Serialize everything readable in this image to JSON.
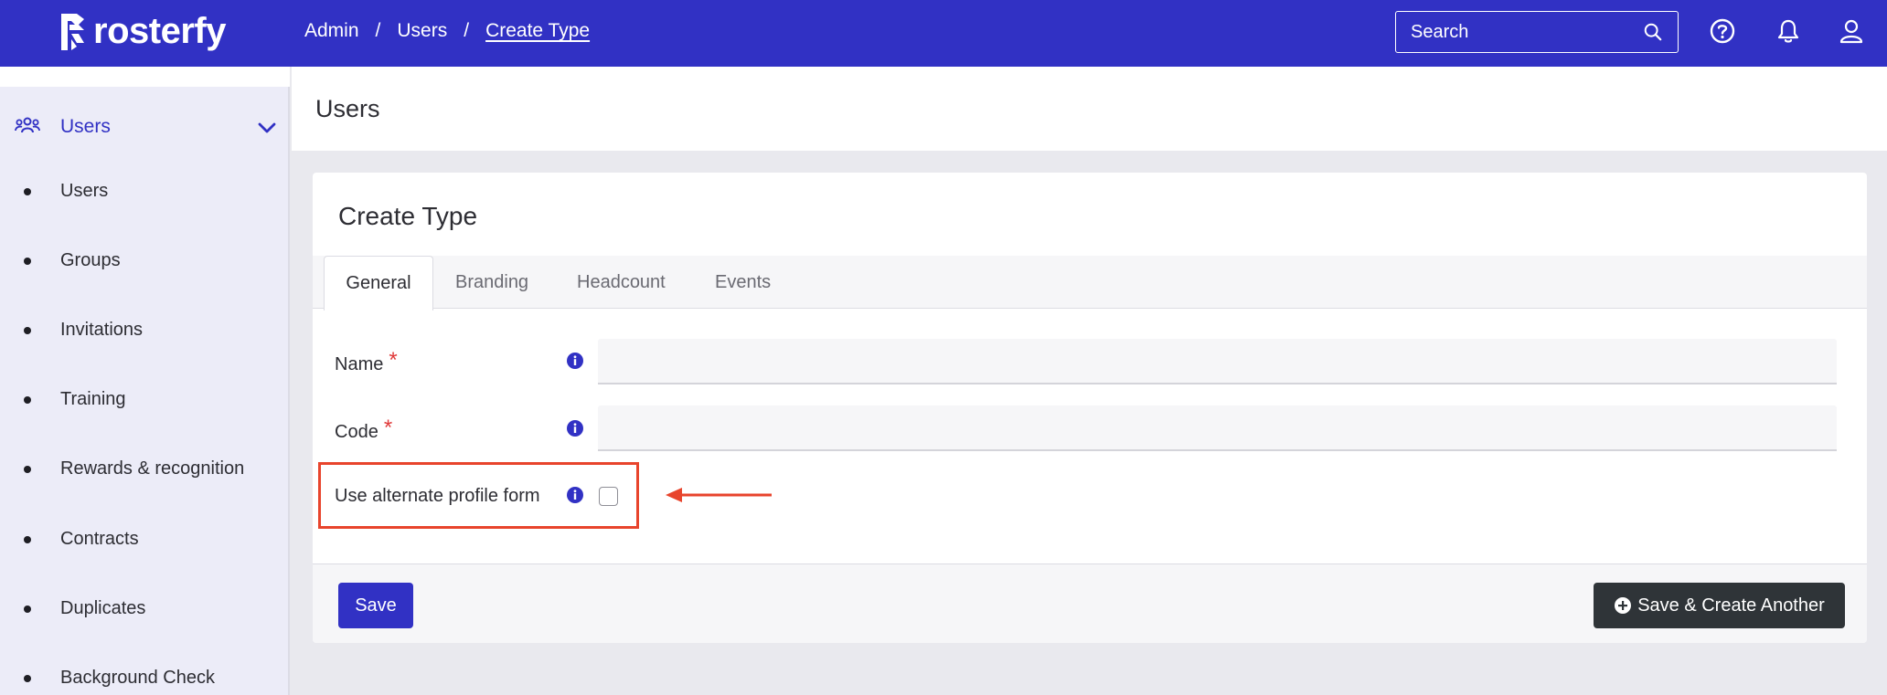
{
  "brand": {
    "name": "rosterfy",
    "accent": "#3131c4",
    "logo_icon": "rosterfy-logo-icon"
  },
  "breadcrumb": {
    "items": [
      "Admin",
      "Users"
    ],
    "current": "Create Type",
    "separator": "/"
  },
  "search": {
    "placeholder": "Search",
    "icon": "search-icon"
  },
  "top_icons": [
    "help-icon",
    "bell-icon",
    "user-icon"
  ],
  "sidebar": {
    "section": {
      "label": "Users",
      "icon": "users-group-icon",
      "expand_icon": "chevron-down-icon"
    },
    "items": [
      {
        "label": "Users"
      },
      {
        "label": "Groups"
      },
      {
        "label": "Invitations"
      },
      {
        "label": "Training"
      },
      {
        "label": "Rewards & recognition"
      },
      {
        "label": "Contracts"
      },
      {
        "label": "Duplicates"
      },
      {
        "label": "Background Check"
      }
    ]
  },
  "page": {
    "title": "Users"
  },
  "card": {
    "title": "Create Type",
    "tabs": [
      {
        "label": "General",
        "active": true
      },
      {
        "label": "Branding",
        "active": false
      },
      {
        "label": "Headcount",
        "active": false
      },
      {
        "label": "Events",
        "active": false
      }
    ],
    "fields": {
      "name": {
        "label": "Name",
        "required_mark": "*",
        "value": "",
        "placeholder": ""
      },
      "code": {
        "label": "Code",
        "required_mark": "*",
        "value": "",
        "placeholder": ""
      },
      "alt_profile": {
        "label": "Use alternate profile form",
        "checked": false
      }
    },
    "footer": {
      "save_label": "Save",
      "save_another_label": "Save & Create Another"
    }
  },
  "annotation": {
    "highlight_color": "#e8442c"
  }
}
